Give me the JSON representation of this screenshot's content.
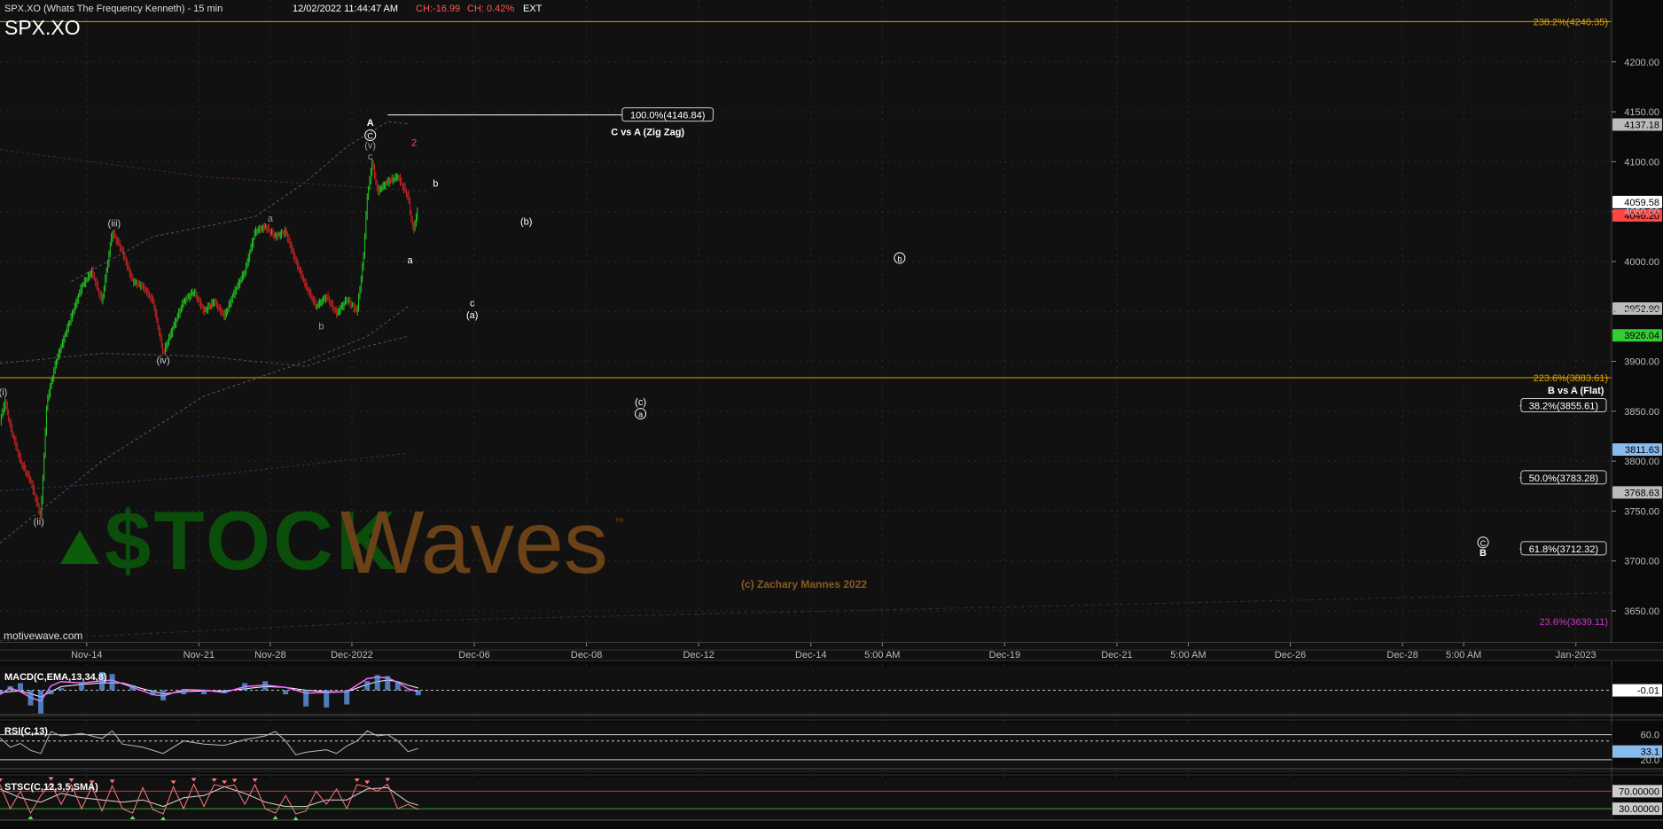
{
  "header": {
    "title": "SPX.XO (Whats The Frequency Kenneth) - 15 min",
    "datetime": "12/02/2022 11:44:47 AM",
    "change_abs": "CH:-16.99",
    "change_pct": "CH: 0.42%",
    "session": "EXT",
    "symbol": "SPX.XO"
  },
  "watermark": {
    "brand_stock": "$TOCK",
    "brand_waves": "Waves",
    "trademark": "™",
    "copyright": "(c) Zachary Mannes 2022",
    "site": "motivewave.com"
  },
  "colors": {
    "background": "#111111",
    "grid": "#2a2a2a",
    "up_bar": "#22cc22",
    "down_bar": "#cc2222",
    "fib_orange": "#e0a000",
    "fib_magenta": "#cc33cc",
    "macd_line": "#ff66ff",
    "macd_hist": "#66aaff",
    "signal_line": "#ffffff",
    "rsi_line": "#bbbbbb",
    "stoch_line": "#ff7777",
    "stoch_signal": "#dddddd",
    "band_line": "#555577"
  },
  "chart_data": {
    "type": "candlestick",
    "title": "SPX.XO (Whats The Frequency Kenneth) - 15 min",
    "ylim": [
      3618,
      4262
    ],
    "y_ticks": [
      4200,
      4150,
      4100,
      4050,
      4000,
      3950,
      3900,
      3850,
      3800,
      3750,
      3700,
      3650
    ],
    "y_tick_labels": [
      "4200.00",
      "4150.00",
      "4100.00",
      "4050.00",
      "4000.00",
      "3950.00",
      "3900.00",
      "3850.00",
      "3800.00",
      "3750.00",
      "3700.00",
      "3650.00"
    ],
    "x_ticks": [
      "Nov-14",
      "Nov-21",
      "Nov-28",
      "Dec-2022",
      "Dec-06",
      "Dec-08",
      "Dec-12",
      "Dec-14",
      "5:00 AM",
      "Dec-19",
      "Dec-21",
      "5:00 AM",
      "Dec-26",
      "Dec-28",
      "5:00 AM",
      "Jan-2023"
    ],
    "x_tick_index": [
      8.5,
      19.5,
      26.5,
      34.5,
      46.5,
      57.5,
      68.5,
      79.5,
      86.5,
      98.5,
      109.5,
      116.5,
      126.5,
      137.5,
      143.5,
      154.5
    ],
    "x_range": [
      0,
      158
    ],
    "price_path": [
      [
        0,
        3840
      ],
      [
        0.5,
        3860
      ],
      [
        1,
        3835
      ],
      [
        2,
        3800
      ],
      [
        3,
        3780
      ],
      [
        4,
        3745
      ],
      [
        4.6,
        3860
      ],
      [
        5.5,
        3900
      ],
      [
        6.5,
        3930
      ],
      [
        8,
        3975
      ],
      [
        9,
        3990
      ],
      [
        10,
        3960
      ],
      [
        11,
        4030
      ],
      [
        12,
        4010
      ],
      [
        13,
        3980
      ],
      [
        14,
        3975
      ],
      [
        15,
        3960
      ],
      [
        16,
        3908
      ],
      [
        17,
        3935
      ],
      [
        18,
        3960
      ],
      [
        19,
        3970
      ],
      [
        20,
        3950
      ],
      [
        21,
        3960
      ],
      [
        22,
        3945
      ],
      [
        23,
        3970
      ],
      [
        24,
        3990
      ],
      [
        25,
        4030
      ],
      [
        26,
        4035
      ],
      [
        27,
        4025
      ],
      [
        28,
        4030
      ],
      [
        29,
        4000
      ],
      [
        30,
        3975
      ],
      [
        31,
        3955
      ],
      [
        32,
        3965
      ],
      [
        33,
        3948
      ],
      [
        34,
        3962
      ],
      [
        35,
        3950
      ],
      [
        35.6,
        4000
      ],
      [
        36,
        4065
      ],
      [
        36.5,
        4100
      ],
      [
        37,
        4070
      ],
      [
        38,
        4080
      ],
      [
        39,
        4085
      ],
      [
        40,
        4065
      ],
      [
        40.5,
        4030
      ],
      [
        41,
        4055
      ]
    ],
    "current_price": 4059.58,
    "price_badges": [
      {
        "label": "4137.18",
        "value": 4137.18,
        "color": "#bbbbbb"
      },
      {
        "label": "4059.58",
        "value": 4059.58,
        "color": "#ffffff"
      },
      {
        "label": "4046.20",
        "value": 4046.2,
        "color": "#ff4444"
      },
      {
        "label": "3952.90",
        "value": 3952.9,
        "color": "#bbbbbb"
      },
      {
        "label": "3926.04",
        "value": 3926.04,
        "color": "#33cc33"
      },
      {
        "label": "3811.63",
        "value": 3811.63,
        "color": "#88bbee"
      },
      {
        "label": "3768.63",
        "value": 3768.63,
        "color": "#bbbbbb"
      }
    ],
    "fib_levels": [
      {
        "label": "238.2%(4240.35)",
        "value": 4240.35,
        "color": "#e0a000",
        "style": "full"
      },
      {
        "label": "223.6%(3883.61)",
        "value": 3883.61,
        "color": "#e0a000",
        "style": "full"
      },
      {
        "label": "23.6%(3639.11)",
        "value": 3639.11,
        "color": "#cc33cc",
        "style": "tag"
      }
    ],
    "projections": [
      {
        "group": "C vs A (Zig Zag)",
        "label": "100.0%(4146.84)",
        "value": 4146.84,
        "x_start": 38,
        "x_end": 68
      },
      {
        "group": "B vs A (Flat)",
        "label": "38.2%(3855.61)",
        "value": 3855.61,
        "x_start": 149,
        "x_end": 158
      },
      {
        "group": "B vs A (Flat)",
        "label": "50.0%(3783.28)",
        "value": 3783.28,
        "x_start": 149,
        "x_end": 158
      },
      {
        "group": "B vs A (Flat)",
        "label": "61.8%(3712.32)",
        "value": 3712.32,
        "x_start": 149,
        "x_end": 158
      }
    ],
    "projection_groups": [
      {
        "label": "C vs A (Zig Zag)",
        "x": 63.5,
        "value": 4130
      },
      {
        "label": "B vs A (Flat)",
        "x": 154.5,
        "value": 3871
      }
    ],
    "wave_labels": [
      {
        "text": "(i)",
        "x": 0.3,
        "y": 3866,
        "color": "#cccccc"
      },
      {
        "text": "(ii)",
        "x": 3.8,
        "y": 3736,
        "color": "#cccccc"
      },
      {
        "text": "(iii)",
        "x": 11.2,
        "y": 4035,
        "color": "#cccccc"
      },
      {
        "text": "(iv)",
        "x": 16,
        "y": 3898,
        "color": "#cccccc"
      },
      {
        "text": "a",
        "x": 26.5,
        "y": 4040,
        "color": "#999999"
      },
      {
        "text": "b",
        "x": 31.5,
        "y": 3932,
        "color": "#999999"
      },
      {
        "text": "c",
        "x": 36.3,
        "y": 4102,
        "color": "#999999"
      },
      {
        "text": "(v)",
        "x": 36.3,
        "y": 4113,
        "color": "#999999"
      },
      {
        "text": "C",
        "x": 36.3,
        "y": 4123,
        "color": "#ffffff",
        "circled": true
      },
      {
        "text": "A",
        "x": 36.3,
        "y": 4136,
        "color": "#ffffff",
        "bold": true
      },
      {
        "text": "2",
        "x": 40.6,
        "y": 4116,
        "color": "#ff4444"
      },
      {
        "text": "b",
        "x": 42.7,
        "y": 4075,
        "color": "#ffffff"
      },
      {
        "text": "a",
        "x": 40.2,
        "y": 3998,
        "color": "#ffffff"
      },
      {
        "text": "c",
        "x": 46.3,
        "y": 3955,
        "color": "#ffffff"
      },
      {
        "text": "(a)",
        "x": 46.3,
        "y": 3943,
        "color": "#ffffff"
      },
      {
        "text": "(b)",
        "x": 51.6,
        "y": 4037,
        "color": "#ffffff"
      },
      {
        "text": "b",
        "x": 88.2,
        "y": 4000,
        "color": "#ffffff",
        "circled": true
      },
      {
        "text": "(c)",
        "x": 62.8,
        "y": 3856,
        "color": "#ffffff"
      },
      {
        "text": "a",
        "x": 62.8,
        "y": 3844,
        "color": "#ffffff",
        "circled": true
      },
      {
        "text": "C",
        "x": 145.4,
        "y": 3715,
        "color": "#ffffff",
        "circled": true
      },
      {
        "text": "B",
        "x": 145.4,
        "y": 3705,
        "color": "#ffffff",
        "bold": true
      }
    ],
    "upper_band": [
      [
        7,
        3980
      ],
      [
        15,
        4025
      ],
      [
        25,
        4045
      ],
      [
        30,
        4080
      ],
      [
        34,
        4115
      ],
      [
        38,
        4140
      ],
      [
        40,
        4138
      ]
    ],
    "lower_band": [
      [
        0,
        3898
      ],
      [
        10,
        3908
      ],
      [
        20,
        3905
      ],
      [
        30,
        3895
      ],
      [
        36,
        3915
      ],
      [
        40,
        3925
      ]
    ],
    "lower_env": [
      [
        0,
        3718
      ],
      [
        10,
        3800
      ],
      [
        20,
        3865
      ],
      [
        30,
        3900
      ],
      [
        36,
        3925
      ],
      [
        40,
        3955
      ]
    ],
    "macd": {
      "title": "MACD(C,EMA,13,34,8)",
      "ylim": [
        -3,
        3
      ],
      "value_label": "-0.01",
      "value": -0.01,
      "line": [
        [
          0,
          -0.6
        ],
        [
          1,
          0.3
        ],
        [
          2,
          -0.2
        ],
        [
          3,
          -1.0
        ],
        [
          4,
          -1.5
        ],
        [
          5,
          0.6
        ],
        [
          6,
          1.2
        ],
        [
          8,
          1.0
        ],
        [
          10,
          1.3
        ],
        [
          11,
          1.4
        ],
        [
          13,
          0.4
        ],
        [
          15,
          -0.6
        ],
        [
          16,
          -0.8
        ],
        [
          18,
          0.1
        ],
        [
          20,
          0.0
        ],
        [
          22,
          -0.3
        ],
        [
          24,
          0.5
        ],
        [
          26,
          0.7
        ],
        [
          28,
          0.4
        ],
        [
          30,
          -0.4
        ],
        [
          32,
          -0.3
        ],
        [
          34,
          -0.2
        ],
        [
          36,
          1.6
        ],
        [
          37,
          1.8
        ],
        [
          38,
          1.7
        ],
        [
          39,
          1.1
        ],
        [
          40,
          0.2
        ],
        [
          41,
          -0.2
        ]
      ],
      "signal": [
        [
          0,
          -0.3
        ],
        [
          2,
          -0.1
        ],
        [
          4,
          -0.9
        ],
        [
          6,
          0.5
        ],
        [
          8,
          0.8
        ],
        [
          10,
          1.0
        ],
        [
          12,
          1.0
        ],
        [
          14,
          0.2
        ],
        [
          16,
          -0.5
        ],
        [
          18,
          -0.2
        ],
        [
          20,
          -0.1
        ],
        [
          22,
          -0.1
        ],
        [
          24,
          0.2
        ],
        [
          26,
          0.5
        ],
        [
          28,
          0.4
        ],
        [
          30,
          0.0
        ],
        [
          32,
          -0.2
        ],
        [
          34,
          -0.2
        ],
        [
          36,
          0.8
        ],
        [
          37,
          1.2
        ],
        [
          38,
          1.4
        ],
        [
          39,
          1.2
        ],
        [
          40,
          0.7
        ],
        [
          41,
          0.3
        ]
      ]
    },
    "rsi": {
      "title": "RSI(C,13)",
      "ylim": [
        10,
        75
      ],
      "levels": [
        60,
        20
      ],
      "mid": 50,
      "value_label": "33.1",
      "value": 33.1,
      "line": [
        [
          0,
          55
        ],
        [
          1,
          40
        ],
        [
          2,
          46
        ],
        [
          3,
          35
        ],
        [
          4,
          30
        ],
        [
          5,
          65
        ],
        [
          6,
          58
        ],
        [
          8,
          62
        ],
        [
          10,
          54
        ],
        [
          11,
          66
        ],
        [
          12,
          45
        ],
        [
          14,
          40
        ],
        [
          16,
          30
        ],
        [
          18,
          50
        ],
        [
          20,
          45
        ],
        [
          22,
          43
        ],
        [
          24,
          52
        ],
        [
          26,
          58
        ],
        [
          27,
          65
        ],
        [
          28,
          50
        ],
        [
          29,
          28
        ],
        [
          30,
          32
        ],
        [
          32,
          36
        ],
        [
          33,
          30
        ],
        [
          34,
          42
        ],
        [
          35,
          50
        ],
        [
          36,
          66
        ],
        [
          37,
          58
        ],
        [
          38,
          60
        ],
        [
          39,
          50
        ],
        [
          40,
          33
        ],
        [
          41,
          38
        ]
      ]
    },
    "stoch": {
      "title": "STSC(C,12,3,5,SMA)",
      "ylim": [
        10,
        95
      ],
      "levels": [
        70,
        30
      ],
      "value_label_hi": "70.00000",
      "value_label_lo": "30.00000",
      "value_hi": 70,
      "value_lo": 30,
      "line": [
        [
          0,
          85
        ],
        [
          1,
          30
        ],
        [
          2,
          70
        ],
        [
          3,
          20
        ],
        [
          4,
          60
        ],
        [
          5,
          88
        ],
        [
          6,
          40
        ],
        [
          7,
          85
        ],
        [
          8,
          30
        ],
        [
          9,
          80
        ],
        [
          10,
          25
        ],
        [
          11,
          82
        ],
        [
          12,
          30
        ],
        [
          13,
          20
        ],
        [
          14,
          78
        ],
        [
          15,
          28
        ],
        [
          16,
          18
        ],
        [
          17,
          80
        ],
        [
          18,
          30
        ],
        [
          19,
          86
        ],
        [
          20,
          35
        ],
        [
          21,
          85
        ],
        [
          22,
          80
        ],
        [
          23,
          84
        ],
        [
          24,
          40
        ],
        [
          25,
          85
        ],
        [
          26,
          30
        ],
        [
          27,
          20
        ],
        [
          28,
          60
        ],
        [
          29,
          18
        ],
        [
          30,
          25
        ],
        [
          31,
          70
        ],
        [
          32,
          40
        ],
        [
          33,
          75
        ],
        [
          34,
          30
        ],
        [
          35,
          85
        ],
        [
          36,
          80
        ],
        [
          37,
          70
        ],
        [
          38,
          86
        ],
        [
          39,
          30
        ],
        [
          40,
          40
        ],
        [
          41,
          28
        ]
      ],
      "signal": [
        [
          0,
          75
        ],
        [
          2,
          55
        ],
        [
          4,
          45
        ],
        [
          6,
          65
        ],
        [
          8,
          55
        ],
        [
          10,
          50
        ],
        [
          12,
          45
        ],
        [
          14,
          50
        ],
        [
          16,
          35
        ],
        [
          18,
          55
        ],
        [
          20,
          60
        ],
        [
          22,
          80
        ],
        [
          24,
          65
        ],
        [
          26,
          45
        ],
        [
          28,
          35
        ],
        [
          30,
          35
        ],
        [
          32,
          50
        ],
        [
          34,
          50
        ],
        [
          36,
          75
        ],
        [
          38,
          78
        ],
        [
          40,
          45
        ],
        [
          41,
          38
        ]
      ]
    }
  }
}
